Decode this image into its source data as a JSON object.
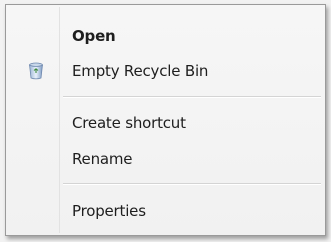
{
  "context_menu": {
    "items": [
      {
        "label": "Open",
        "icon": null,
        "default": true
      },
      {
        "label": "Empty Recycle Bin",
        "icon": "recycle-bin-icon",
        "default": false
      },
      {
        "label": "Create shortcut",
        "icon": null,
        "default": false
      },
      {
        "label": "Rename",
        "icon": null,
        "default": false
      },
      {
        "label": "Properties",
        "icon": null,
        "default": false
      }
    ]
  }
}
